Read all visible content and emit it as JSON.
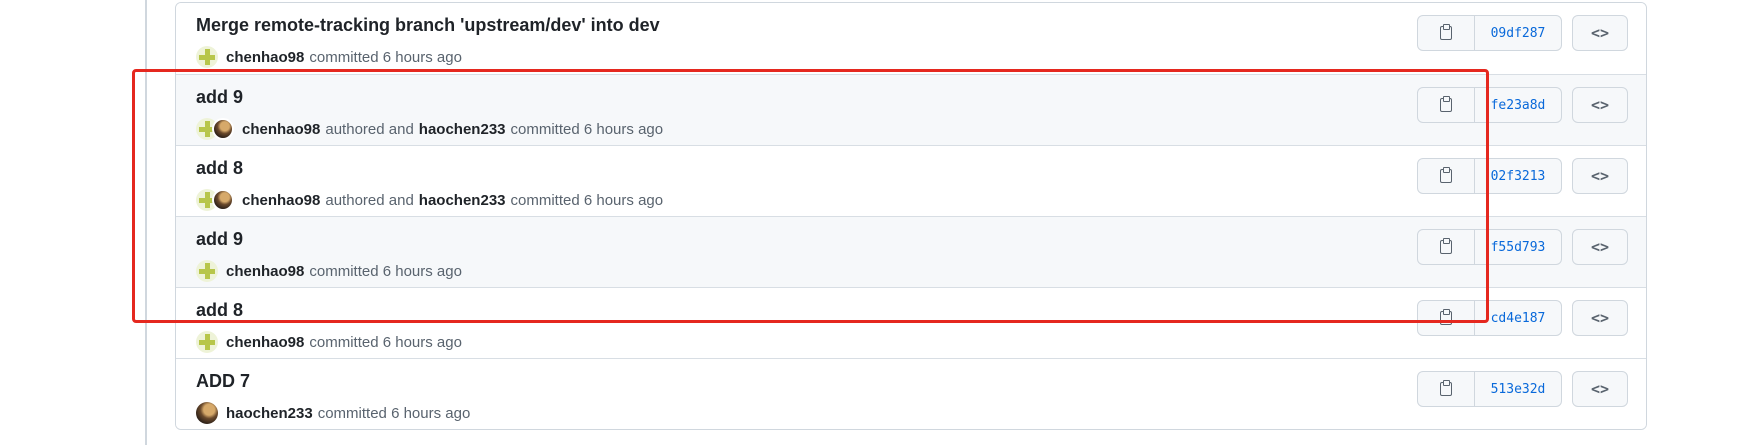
{
  "commits": [
    {
      "title": "Merge remote-tracking branch 'upstream/dev' into dev",
      "author": "chenhao98",
      "authored_text": "",
      "committer": "",
      "committed_text": "committed 6 hours ago",
      "sha": "09df287",
      "avatars": [
        "green"
      ],
      "shaded": false
    },
    {
      "title": "add 9",
      "author": "chenhao98",
      "authored_text": "authored and",
      "committer": "haochen233",
      "committed_text": "committed 6 hours ago",
      "sha": "fe23a8d",
      "avatars": [
        "green",
        "photo"
      ],
      "shaded": true
    },
    {
      "title": "add 8",
      "author": "chenhao98",
      "authored_text": "authored and",
      "committer": "haochen233",
      "committed_text": "committed 6 hours ago",
      "sha": "02f3213",
      "avatars": [
        "green",
        "photo"
      ],
      "shaded": false
    },
    {
      "title": "add 9",
      "author": "chenhao98",
      "authored_text": "",
      "committer": "",
      "committed_text": "committed 6 hours ago",
      "sha": "f55d793",
      "avatars": [
        "green"
      ],
      "shaded": true
    },
    {
      "title": "add 8",
      "author": "chenhao98",
      "authored_text": "",
      "committer": "",
      "committed_text": "committed 6 hours ago",
      "sha": "cd4e187",
      "avatars": [
        "green"
      ],
      "shaded": false
    },
    {
      "title": "ADD 7",
      "author": "haochen233",
      "authored_text": "",
      "committer": "",
      "committed_text": "committed 6 hours ago",
      "sha": "513e32d",
      "avatars": [
        "photo"
      ],
      "shaded": false
    }
  ],
  "browse_label": "<>",
  "colors": {
    "highlight": "#e5281f",
    "sha_link": "#0969da"
  }
}
